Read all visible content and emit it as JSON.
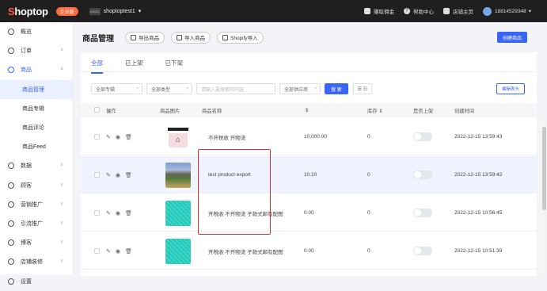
{
  "topbar": {
    "logo_part1": "S",
    "logo_part2": "hoptop",
    "badge": "企业版",
    "store_logo": "LOGO",
    "store_name": "shoptoptest1",
    "earn": "赚取佣金",
    "help": "帮助中心",
    "store_home": "店铺主页",
    "phone": "18814529348"
  },
  "sidebar": {
    "items": [
      {
        "label": "概览",
        "icon": "overview-icon"
      },
      {
        "label": "订单",
        "icon": "order-icon",
        "chevron": "˅"
      },
      {
        "label": "商品",
        "icon": "product-icon",
        "chevron": "˄"
      }
    ],
    "sub_items": [
      "商品管理",
      "商品专辑",
      "商品评论",
      "商品Feed"
    ],
    "items2": [
      {
        "label": "数据",
        "icon": "data-icon",
        "chevron": "˅"
      },
      {
        "label": "顾客",
        "icon": "customer-icon",
        "chevron": "˅"
      },
      {
        "label": "营销推广",
        "icon": "marketing-icon",
        "chevron": "˅"
      },
      {
        "label": "引流推广",
        "icon": "traffic-icon",
        "chevron": "˅"
      },
      {
        "label": "博客",
        "icon": "blog-icon",
        "chevron": "˅"
      },
      {
        "label": "店铺装修",
        "icon": "decor-icon",
        "chevron": "˅"
      },
      {
        "label": "设置",
        "icon": "settings-icon"
      }
    ]
  },
  "header": {
    "title": "商品管理",
    "export": "导出商品",
    "import": "导入商品",
    "shopify": "Shopify导入",
    "create": "创建商品"
  },
  "tabs": [
    "全部",
    "已上架",
    "已下架"
  ],
  "filters": {
    "album": "全部专辑",
    "type": "全部类型",
    "search_placeholder": "请输入要搜索的内容",
    "supplier": "全部供应商",
    "search_btn": "搜 索",
    "view_btn": "☰ ☷",
    "edit_header": "编辑表头"
  },
  "table": {
    "headers": {
      "ops": "操作",
      "image": "商品图片",
      "name": "商品名称",
      "price": "$",
      "stock": "库存 ⇕",
      "listed": "是否上架",
      "created": "创建时间"
    },
    "rows": [
      {
        "name": "不开税收 开物流",
        "price": "10,000.00",
        "stock": "0",
        "created": "2022-12-15 13:59:43"
      },
      {
        "name": "test product export",
        "price": "10.10",
        "stock": "0",
        "created": "2022-12-15 13:59:42"
      },
      {
        "name": "开税收 不开物流 子款式邮有配图",
        "price": "0.00",
        "stock": "0",
        "created": "2022-12-15 10:56:45"
      },
      {
        "name": "开税收 不开物流 子款式邮有配图",
        "price": "0.00",
        "stock": "0",
        "created": "2022-12-15 10:51:39"
      }
    ]
  },
  "colors": {
    "accent": "#3a64f5",
    "brand_orange": "#ff6a3d",
    "highlight_box": "#e0302a"
  }
}
